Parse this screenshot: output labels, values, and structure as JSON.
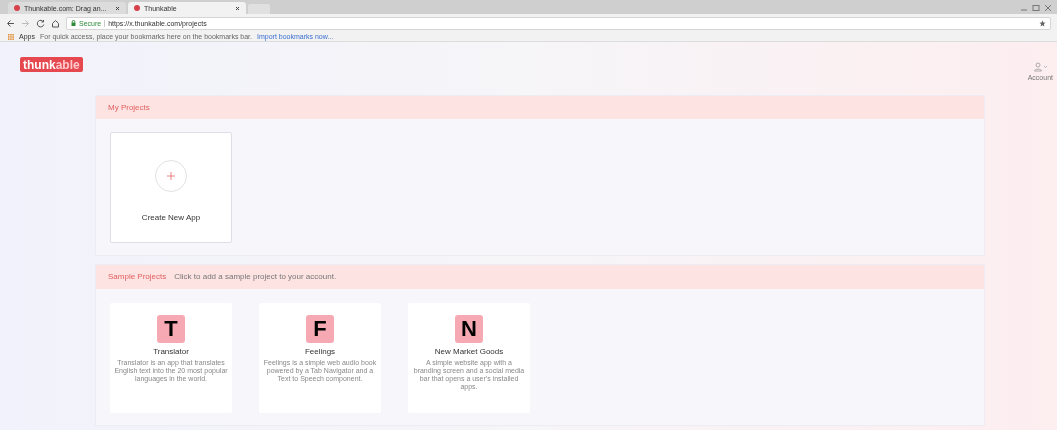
{
  "browser": {
    "tabs": [
      {
        "title": "Thunkable.com: Drag an...",
        "selected": false
      },
      {
        "title": "Thunkable",
        "selected": true
      }
    ],
    "url_secure": "Secure",
    "url": "https://x.thunkable.com/projects",
    "bookmarks": {
      "apps": "Apps",
      "hint": "For quick access, place your bookmarks here on the bookmarks bar.",
      "link": "Import bookmarks now..."
    }
  },
  "logo": {
    "part1": "thunk",
    "part2": "able"
  },
  "account": {
    "label": "Account"
  },
  "my_projects": {
    "title": "My Projects",
    "create_label": "Create New App"
  },
  "sample_projects": {
    "title": "Sample Projects",
    "hint": "Click to add a sample project to your account.",
    "items": [
      {
        "letter": "T",
        "name": "Translator",
        "description": "Translator is an app that translates English text into the 20 most popular languages in the world."
      },
      {
        "letter": "F",
        "name": "Feelings",
        "description": "Feelings is a simple web audio book powered by a Tab Navigator and a Text to Speech component."
      },
      {
        "letter": "N",
        "name": "New Market Goods",
        "description": "A simple website app with a branding screen and a social media bar that opens a user's installed apps."
      }
    ]
  }
}
